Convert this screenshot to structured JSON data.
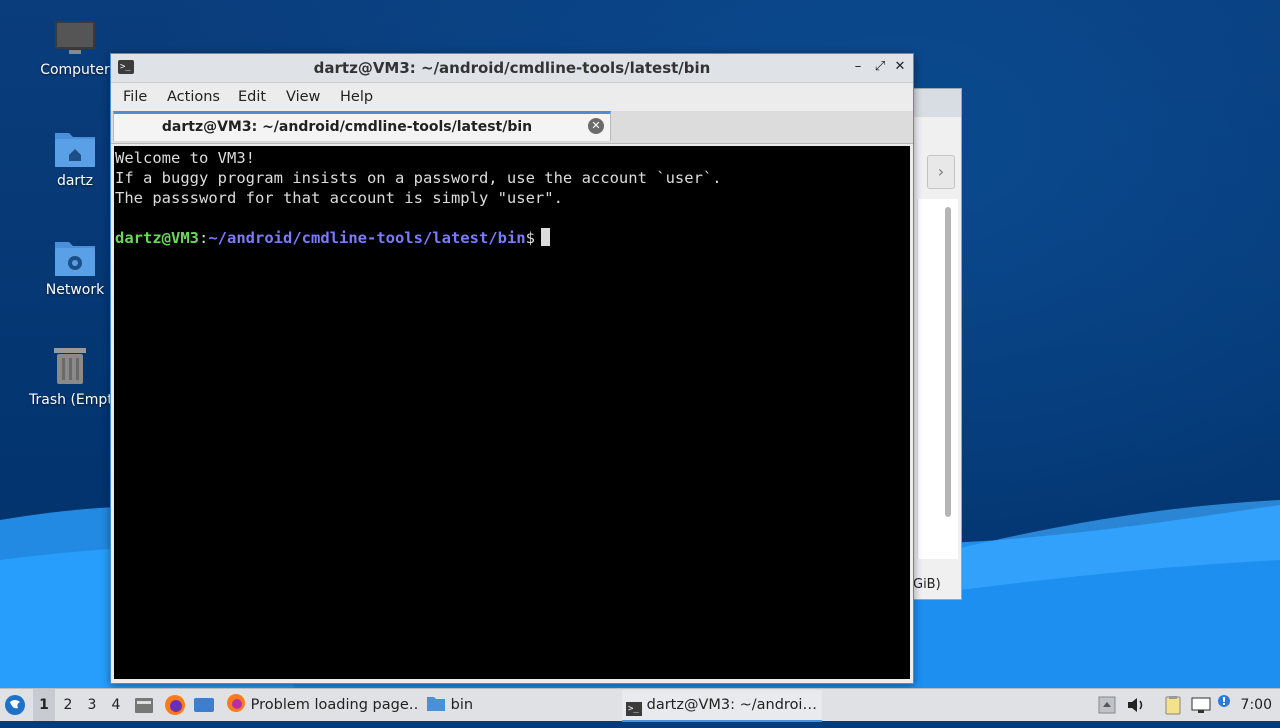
{
  "desktop": {
    "icons": [
      {
        "label": "Computer"
      },
      {
        "label": "dartz"
      },
      {
        "label": "Network"
      },
      {
        "label": "Trash (Empty)"
      }
    ]
  },
  "background_window": {
    "status_text": "GiB)"
  },
  "terminal_window": {
    "title": "dartz@VM3: ~/android/cmdline-tools/latest/bin",
    "menu": [
      "File",
      "Actions",
      "Edit",
      "View",
      "Help"
    ],
    "tab_label": "dartz@VM3: ~/android/cmdline-tools/latest/bin",
    "output_lines": [
      "Welcome to VM3!",
      "If a buggy program insists on a password, use the account `user`.",
      "The passsword for that account is simply \"user\"."
    ],
    "prompt": {
      "user_host": "dartz@VM3",
      "separator": ":",
      "path": "~/android/cmdline-tools/latest/bin",
      "symbol": "$"
    }
  },
  "taskbar": {
    "workspaces": [
      "1",
      "2",
      "3",
      "4"
    ],
    "active_workspace": "1",
    "tasks": [
      {
        "label": "Problem loading page…",
        "icon": "firefox-icon"
      },
      {
        "label": "bin",
        "icon": "folder-icon"
      },
      {
        "label": "dartz@VM3: ~/androi…",
        "icon": "terminal-icon"
      }
    ],
    "clock": "7:00"
  },
  "colors": {
    "accent": "#4a90d9",
    "prompt_user": "#6bd65a",
    "prompt_path": "#7b7bff",
    "desktop_bg": "#043b7a"
  }
}
